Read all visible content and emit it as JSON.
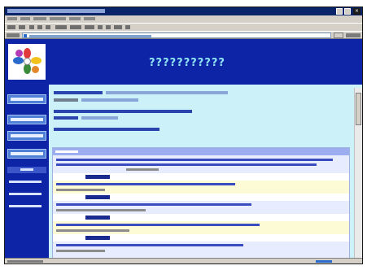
{
  "browser": {
    "title_icon": "ie-icon",
    "close_icon": "close-icon",
    "address_icon": "ie-page-icon"
  },
  "banner": {
    "logo_text": "???????????"
  },
  "sidebar": {
    "logo_icon": "flower-logo-icon",
    "nav_buttons": 4,
    "nav_links": 3
  },
  "colors": {
    "sidebar": "#0d24a6",
    "banner": "#0d24a6",
    "page_background": "#cdf1f9",
    "nav_button": "#4f7fd6",
    "table_header": "#9caef0",
    "table_body": "#fdfbd6"
  }
}
